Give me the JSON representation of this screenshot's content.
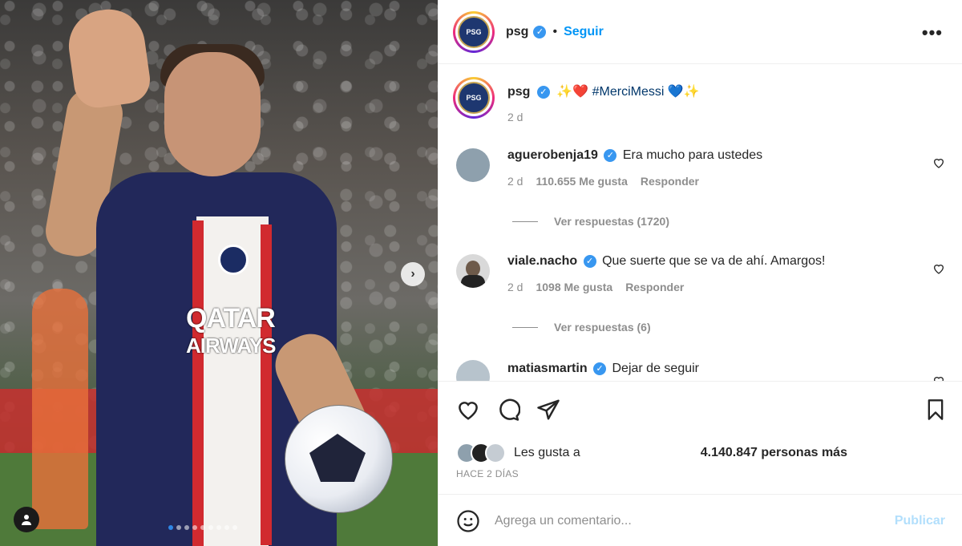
{
  "post": {
    "username": "psg",
    "follow_label": "Seguir",
    "caption_emojis_before": "✨❤️",
    "caption_hashtag": "#MerciMessi",
    "caption_emojis_after": "💙✨",
    "caption_time": "2 d",
    "more_icon": "more-horizontal-icon"
  },
  "photo": {
    "sponsor_line1": "QATAR",
    "sponsor_line2": "AIRWAYS",
    "carousel_dots": 9,
    "active_dot": 0
  },
  "comments": [
    {
      "username": "aguerobenja19",
      "text": "Era mucho para ustedes",
      "time": "2 d",
      "likes": "110.655 Me gusta",
      "reply": "Responder",
      "view_replies": "Ver respuestas (1720)"
    },
    {
      "username": "viale.nacho",
      "text": "Que suerte que se va de ahí. Amargos!",
      "time": "2 d",
      "likes": "1098 Me gusta",
      "reply": "Responder",
      "view_replies": "Ver respuestas (6)"
    },
    {
      "username": "matiasmartin",
      "text": "Dejar de seguir"
    }
  ],
  "likes_bar": {
    "prefix": "Les gusta a",
    "count_text": "4.140.847 personas más",
    "time_ago": "HACE 2 DÍAS"
  },
  "comment_box": {
    "placeholder": "Agrega un comentario...",
    "publish_label": "Publicar"
  },
  "colors": {
    "link_blue": "#0095f6",
    "verified_blue": "#3897f0",
    "muted_gray": "#8e8e8e",
    "publish_disabled": "#b2dffc"
  }
}
